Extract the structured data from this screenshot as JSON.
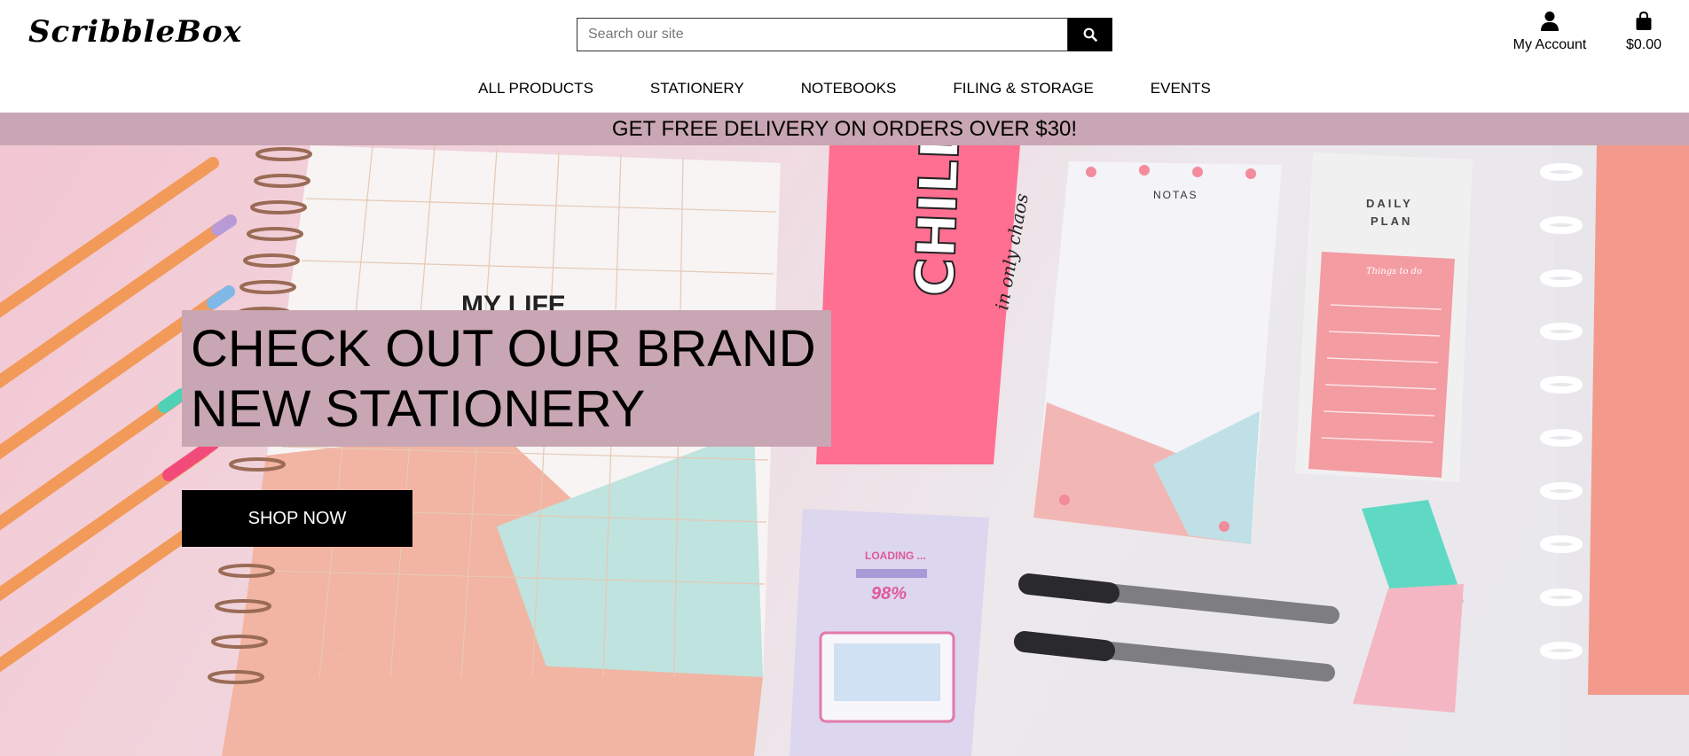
{
  "brand": {
    "logo_text": "ScribbleBox"
  },
  "search": {
    "placeholder": "Search our site",
    "value": "",
    "icon": "search-icon"
  },
  "account": {
    "label": "My Account",
    "icon": "user-icon"
  },
  "cart": {
    "total": "$0.00",
    "icon": "shopping-bag-icon"
  },
  "nav": {
    "items": [
      {
        "label": "ALL PRODUCTS"
      },
      {
        "label": "STATIONERY"
      },
      {
        "label": "NOTEBOOKS"
      },
      {
        "label": "FILING & STORAGE"
      },
      {
        "label": "EVENTS"
      }
    ]
  },
  "banner": {
    "text": "GET FREE DELIVERY ON ORDERS OVER $30!"
  },
  "hero": {
    "title_line1": "CHECK OUT OUR BRAND",
    "title_line2": "NEW STATIONERY",
    "cta_label": "SHOP NOW",
    "image_text": {
      "pencil_case": "CHILL",
      "pencil_case_script": "in only chaos",
      "notepad": "NOTAS",
      "planner_line1": "DAILY",
      "planner_line2": "PLAN",
      "sticky_note": "Things to do",
      "loading_note": "LOADING ...",
      "loading_percent": "98%",
      "notebook_cover": "MY LIFE"
    }
  },
  "colors": {
    "banner_bg": "#c9a6b3",
    "button_bg": "#000000",
    "button_text": "#ffffff"
  }
}
